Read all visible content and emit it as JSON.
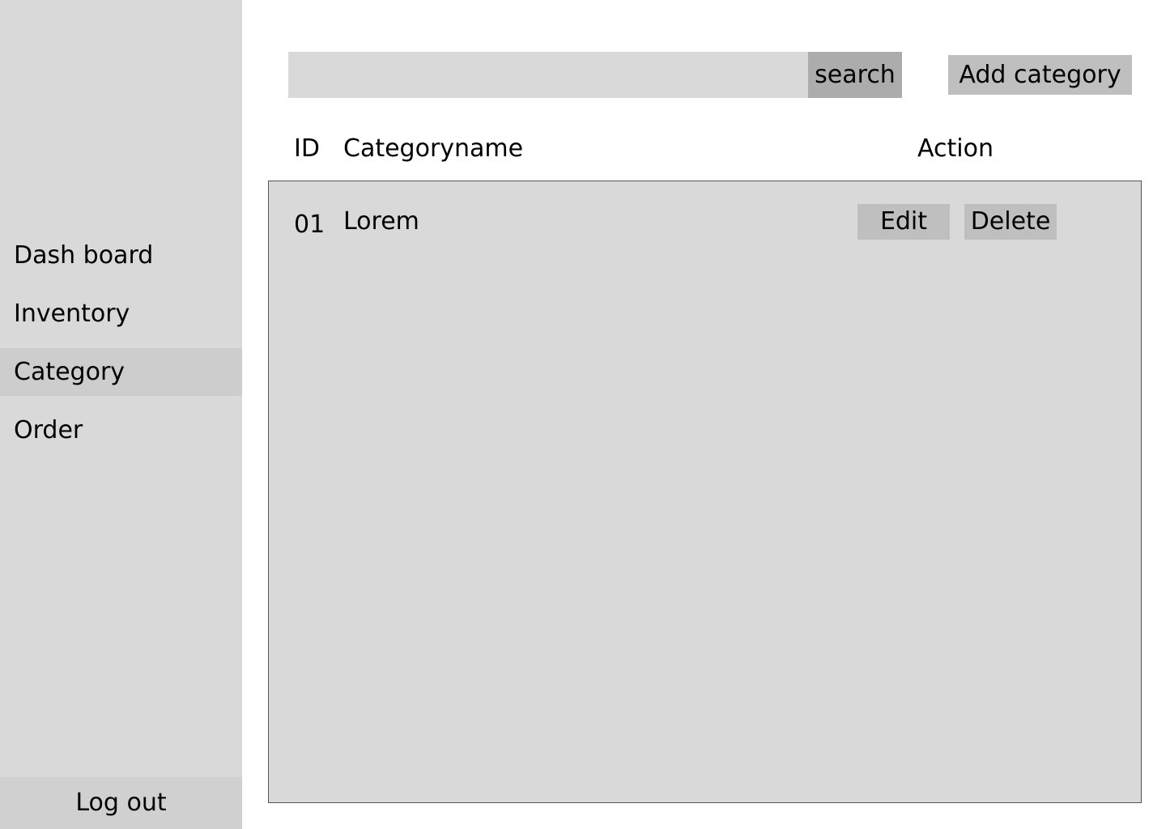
{
  "sidebar": {
    "items": [
      {
        "label": "Dash board",
        "active": false
      },
      {
        "label": "Inventory",
        "active": false
      },
      {
        "label": "Category",
        "active": true
      },
      {
        "label": "Order",
        "active": false
      }
    ],
    "logout_label": "Log out"
  },
  "toolbar": {
    "search_placeholder": "",
    "search_value": "",
    "search_button_label": "search",
    "add_button_label": "Add category"
  },
  "table": {
    "columns": [
      "ID",
      "Categoryname",
      "Action"
    ],
    "rows": [
      {
        "id": "01",
        "name": "Lorem",
        "edit_label": "Edit",
        "delete_label": "Delete"
      }
    ]
  },
  "colors": {
    "sidebar_bg": "#d9d9d9",
    "active_item_bg": "#cdcdcd",
    "search_button_bg": "#acacac",
    "button_bg": "#bfbfbf",
    "table_bg": "#d9d9d9"
  }
}
